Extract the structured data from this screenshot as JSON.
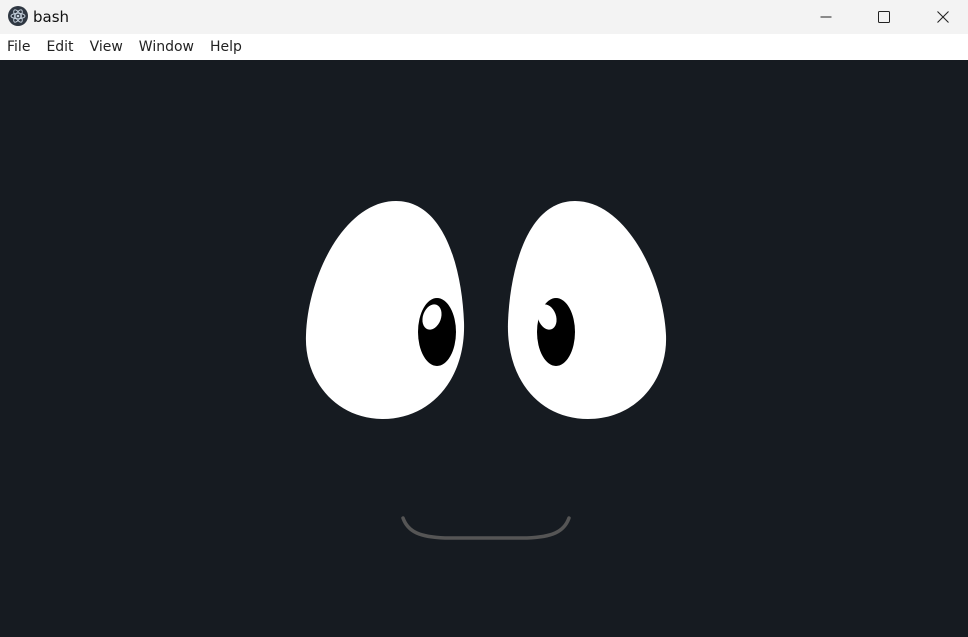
{
  "window": {
    "title": "bash",
    "app_icon": "electron-icon",
    "controls": {
      "minimize": "minimize-icon",
      "maximize": "maximize-icon",
      "close": "close-icon"
    }
  },
  "menu": {
    "items": [
      {
        "label": "File"
      },
      {
        "label": "Edit"
      },
      {
        "label": "View"
      },
      {
        "label": "Window"
      },
      {
        "label": "Help"
      }
    ]
  },
  "colors": {
    "background": "#161b21",
    "eye_white": "#ffffff",
    "pupil": "#000000",
    "mouth": "#555555",
    "titlebar": "#f3f3f3"
  }
}
